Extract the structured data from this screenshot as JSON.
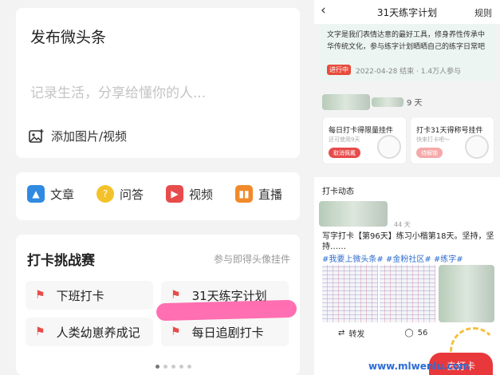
{
  "left": {
    "post_title": "发布微头条",
    "placeholder": "记录生活，分享给懂你的人...",
    "add_media": "添加图片/视频",
    "tools": [
      {
        "label": "文章",
        "icon": "article-icon",
        "color": "#2f8ae0"
      },
      {
        "label": "问答",
        "icon": "qa-icon",
        "color": "#f3c22a"
      },
      {
        "label": "视频",
        "icon": "video-icon",
        "color": "#e84b4b"
      },
      {
        "label": "直播",
        "icon": "live-icon",
        "color": "#f08a2a"
      }
    ],
    "challenge": {
      "title": "打卡挑战赛",
      "subtitle": "参与即得头像挂件",
      "items": [
        "下班打卡",
        "31天练字计划",
        "人类幼崽养成记",
        "每日追剧打卡"
      ]
    }
  },
  "right": {
    "back_icon": "chevron-left-icon",
    "page_title": "31天练字计划",
    "rules": "规则",
    "banner_desc": "文字是我们表情达意的最好工具，修身养性传承中华传统文化，参与练字计划晒晒自己的练字日常吧",
    "badge": "进行中",
    "meta": "2022-04-28 结束 · 1.4万人参与",
    "day_text": "9 天",
    "rewards": [
      {
        "title": "每日打卡得限量挂件",
        "sub": "还可使用9天",
        "button": "取消佩戴",
        "btn_color": "#e84b4b"
      },
      {
        "title": "打卡31天得称号挂件",
        "sub": "快来打卡吧～",
        "button": "待解锁",
        "btn_color": "#f6a9a9"
      }
    ],
    "feed_title": "打卡动态",
    "feed_time": "44 天",
    "post_text": "写字打卡【第96天】练习小楷第18天。坚持，坚持……",
    "post_tags": "#我要上微头条# #金粉社区# #练字#",
    "actions": {
      "repost": "转发",
      "comments": "56"
    },
    "red_button": "去打卡"
  },
  "watermark": "www.mlwenlu.com"
}
